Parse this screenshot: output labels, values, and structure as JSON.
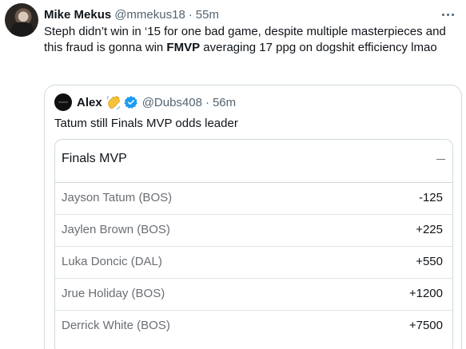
{
  "tweet": {
    "author_name": "Mike Mekus",
    "author_handle": "@mmekus18",
    "separator": "·",
    "timestamp": "55m",
    "text_part1": "Steph didn’t win in ‘15 for one bad game, despite multiple masterpieces and this fraud is gonna win ",
    "text_bold": "FMVP",
    "text_part2": " averaging 17 ppg on dogshit efficiency lmao"
  },
  "quote": {
    "author_name": "Alex",
    "emoji_icon": "waving-hand-icon",
    "verified_icon": "verified-badge-icon",
    "author_handle": "@Dubs408",
    "separator": "·",
    "timestamp": "56m",
    "text": "Tatum still Finals MVP odds leader",
    "card": {
      "title": "Finals MVP",
      "collapse_icon": "minus-icon",
      "rows": [
        {
          "player": "Jayson Tatum (BOS)",
          "odds": "-125"
        },
        {
          "player": "Jaylen Brown (BOS)",
          "odds": "+225"
        },
        {
          "player": "Luka Doncic (DAL)",
          "odds": "+550"
        },
        {
          "player": "Jrue Holiday (BOS)",
          "odds": "+1200"
        },
        {
          "player": "Derrick White (BOS)",
          "odds": "+7500"
        }
      ]
    }
  },
  "colors": {
    "text": "#0f1419",
    "secondary": "#536471",
    "border": "#cfd9de",
    "verified": "#1d9bf0",
    "player_text": "#6a6e73"
  }
}
